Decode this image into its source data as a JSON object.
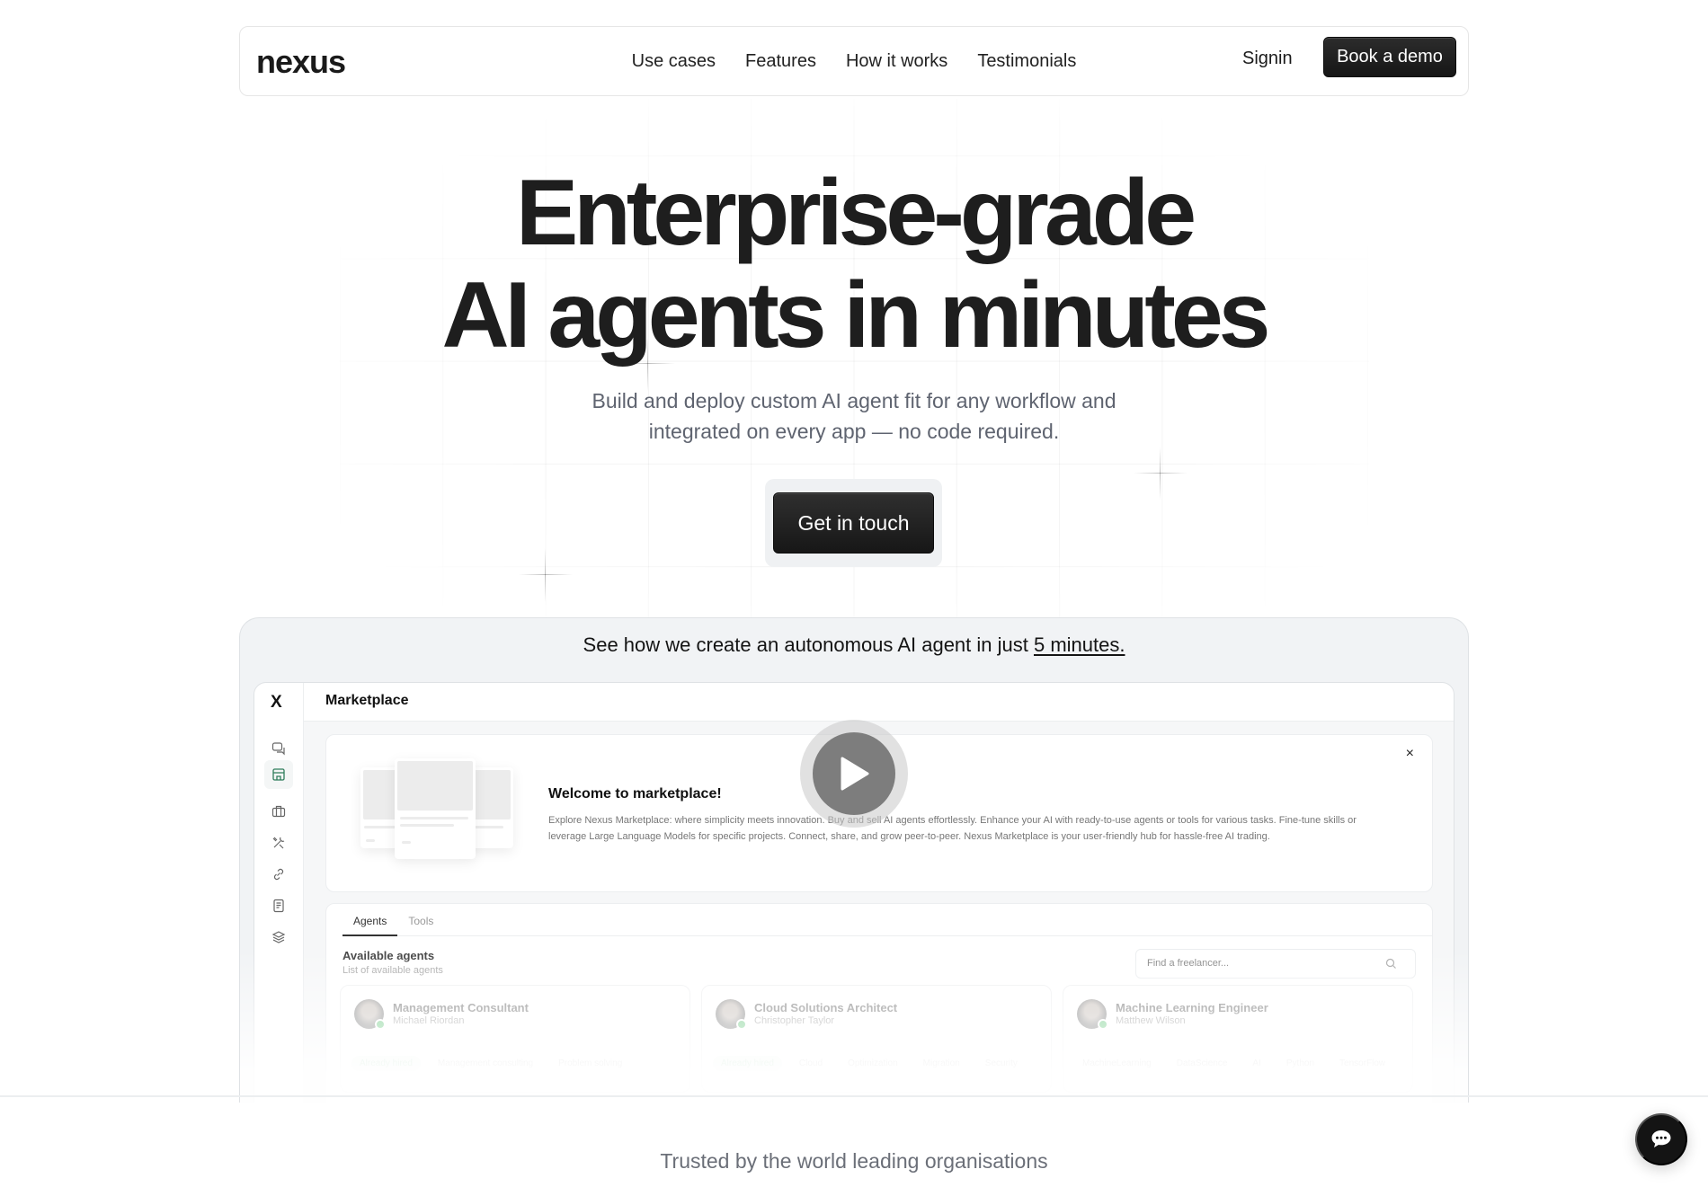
{
  "nav": {
    "logo": "nexus",
    "links": [
      "Use cases",
      "Features",
      "How it works",
      "Testimonials"
    ],
    "signin": "Signin",
    "book_demo": "Book a demo"
  },
  "hero": {
    "title_line1": "Enterprise-grade",
    "title_line2": "AI agents in minutes",
    "subtitle_line1": "Build and deploy custom AI agent fit for any workflow and",
    "subtitle_line2": "integrated on every app — no code required.",
    "cta": "Get in touch"
  },
  "demo": {
    "caption_prefix": "See how we create an autonomous AI agent in just ",
    "caption_link": "5 minutes.",
    "app": {
      "logo": "X",
      "title": "Marketplace",
      "sidebar_icons": [
        "chat-icon",
        "store-icon",
        "briefcase-icon",
        "tools-icon",
        "link-icon",
        "document-icon",
        "layers-icon"
      ],
      "welcome": {
        "title": "Welcome to marketplace!",
        "text": "Explore Nexus Marketplace: where simplicity meets innovation. Buy and sell AI agents effortlessly. Enhance your AI with ready-to-use agents or tools for various tasks. Fine-tune skills or leverage Large Language Models for specific projects. Connect, share, and grow peer-to-peer. Nexus Marketplace is your user-friendly hub for hassle-free AI trading.",
        "close": "×"
      },
      "tabs": [
        {
          "label": "Agents",
          "active": true
        },
        {
          "label": "Tools",
          "active": false
        }
      ],
      "available_title": "Available agents",
      "available_sub": "List of available agents",
      "search_placeholder": "Find a freelancer...",
      "agents": [
        {
          "role": "Management Consultant",
          "name": "Michael Riordan",
          "tags": [
            "Already hired",
            "Management consulting",
            "Problem solving"
          ],
          "hired": true
        },
        {
          "role": "Cloud Solutions Architect",
          "name": "Christopher Taylor",
          "tags": [
            "Already hired",
            "Cloud",
            "Optimization",
            "Migration",
            "Security"
          ],
          "hired": true
        },
        {
          "role": "Machine Learning Engineer",
          "name": "Matthew Wilson",
          "tags": [
            "MachineLearning",
            "DataScience",
            "AI",
            "Python",
            "TensorFlow"
          ],
          "hired": false
        }
      ]
    }
  },
  "trusted": "Trusted by the world leading organisations",
  "colors": {
    "primary_button": "#1b1b1b",
    "accent_green": "#2f7d5b",
    "muted_text": "#5f6470"
  }
}
